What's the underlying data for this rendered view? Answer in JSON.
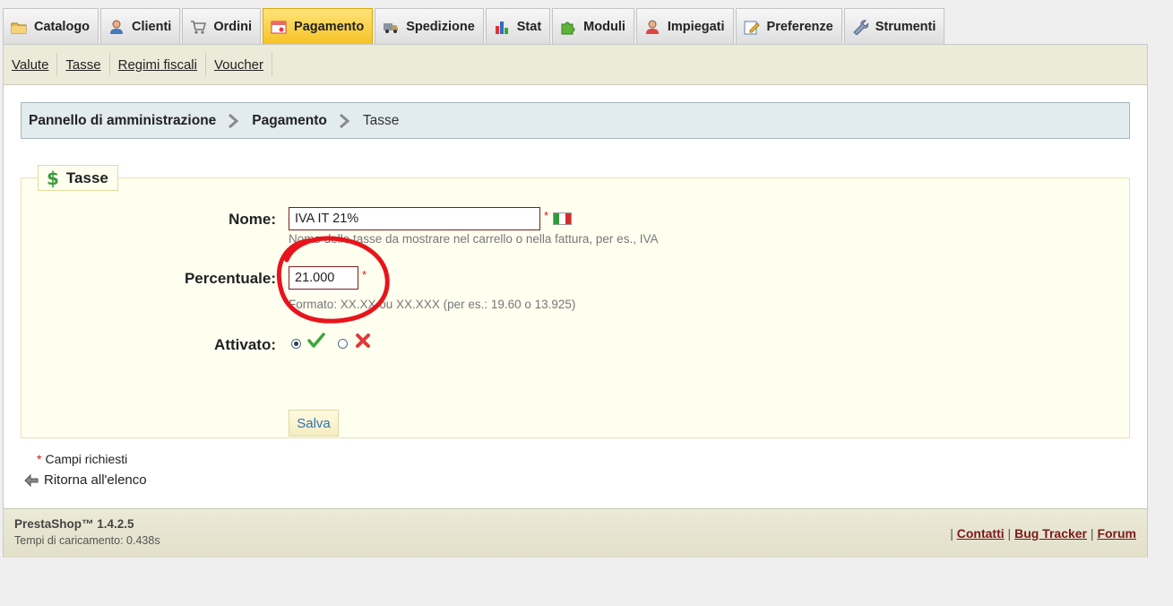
{
  "tabs": [
    {
      "label": "Catalogo",
      "icon": "folder-icon"
    },
    {
      "label": "Clienti",
      "icon": "user-icon"
    },
    {
      "label": "Ordini",
      "icon": "cart-icon"
    },
    {
      "label": "Pagamento",
      "icon": "payment-icon",
      "active": true
    },
    {
      "label": "Spedizione",
      "icon": "truck-icon"
    },
    {
      "label": "Stat",
      "icon": "bar-chart-icon"
    },
    {
      "label": "Moduli",
      "icon": "puzzle-icon"
    },
    {
      "label": "Impiegati",
      "icon": "employee-icon"
    },
    {
      "label": "Preferenze",
      "icon": "edit-icon"
    },
    {
      "label": "Strumenti",
      "icon": "wrench-icon"
    }
  ],
  "subnav": [
    "Valute",
    "Tasse",
    "Regimi fiscali",
    "Voucher"
  ],
  "breadcrumb": {
    "root": "Pannello di amministrazione",
    "section": "Pagamento",
    "current": "Tasse"
  },
  "form": {
    "legend": "Tasse",
    "legend_icon": "dollar-icon",
    "name_label": "Nome:",
    "name_value": "IVA IT 21%",
    "name_hint": "Nome delle tasse da mostrare nel carrello o nella fattura, per es., IVA",
    "flag_icon": "italy-flag-icon",
    "percent_label": "Percentuale:",
    "percent_value": "21.000",
    "percent_hint": "Formato: XX.XX ou XX.XXX (per es.: 19.60 o 13.925)",
    "active_label": "Attivato:",
    "active_selected": "yes",
    "required_marker": "*",
    "save_label": "Salva",
    "required_note": "Campi richiesti"
  },
  "back_link": "Ritorna all'elenco",
  "footer": {
    "version": "PrestaShop™ 1.4.2.5",
    "load_time": "Tempi di caricamento: 0.438s",
    "links": [
      "Contatti",
      "Bug Tracker",
      "Forum"
    ]
  },
  "colors": {
    "active_tab": "#f7c325",
    "annotation_circle": "#e8141b",
    "required": "#d41b1b",
    "link_footer": "#7a1a1a"
  }
}
